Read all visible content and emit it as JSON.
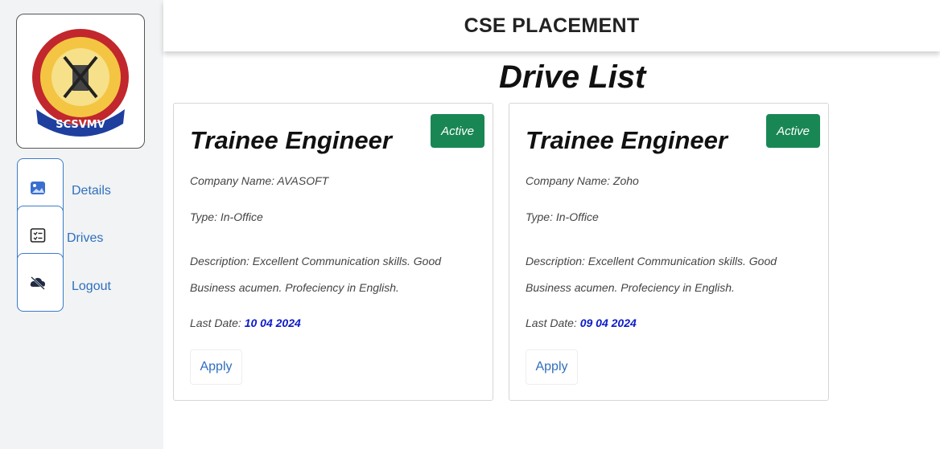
{
  "header": {
    "title": "CSE PLACEMENT"
  },
  "page": {
    "title": "Drive List"
  },
  "sidebar": {
    "logo_text": "SCSVMV",
    "items": [
      {
        "label": "Details",
        "icon": "image-icon"
      },
      {
        "label": "Drives",
        "icon": "list-icon"
      },
      {
        "label": "Logout",
        "icon": "cloud-slash-icon"
      }
    ]
  },
  "drives": [
    {
      "title": "Trainee Engineer",
      "status": "Active",
      "company": "Company Name: AVASOFT",
      "type": "Type: In-Office",
      "description": "Description: Excellent Communication skills. Good Business acumen. Profeciency in English.",
      "last_date_label": "Last Date:",
      "last_date": "10 04 2024",
      "apply_label": "Apply"
    },
    {
      "title": "Trainee Engineer",
      "status": "Active",
      "company": "Company Name: Zoho",
      "type": "Type: In-Office",
      "description": "Description: Excellent Communication skills. Good Business acumen. Profeciency in English.",
      "last_date_label": "Last Date:",
      "last_date": "09 04 2024",
      "apply_label": "Apply"
    }
  ],
  "colors": {
    "accent": "#2f6fbe",
    "badge": "#198754",
    "date": "#0d1bc9"
  }
}
